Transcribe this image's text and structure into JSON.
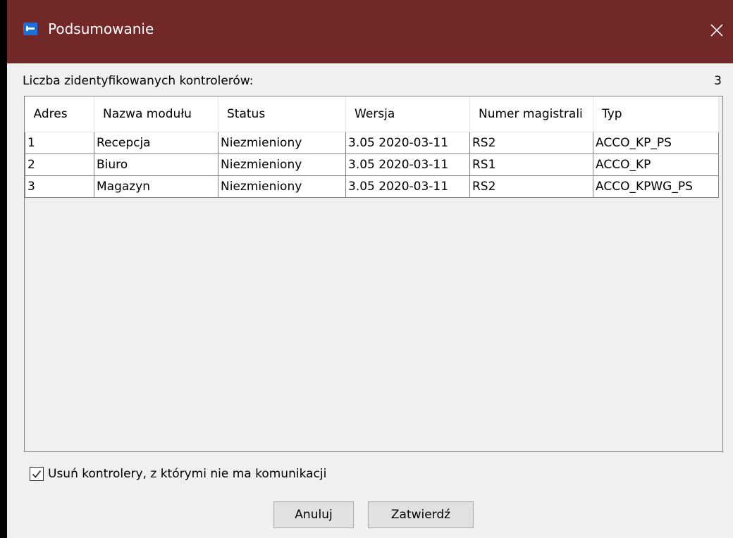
{
  "window": {
    "title": "Podsumowanie",
    "close_label": "×"
  },
  "summary": {
    "count_label": "Liczba zidentyfikowanych kontrolerów:",
    "count_value": "3"
  },
  "table": {
    "columns": [
      "Adres",
      "Nazwa modułu",
      "Status",
      "Wersja",
      "Numer magistrali",
      "Typ"
    ],
    "rows": [
      [
        "1",
        "Recepcja",
        "Niezmieniony",
        "3.05 2020-03-11",
        "RS2",
        "ACCO_KP_PS"
      ],
      [
        "2",
        "Biuro",
        "Niezmieniony",
        "3.05 2020-03-11",
        "RS1",
        "ACCO_KP"
      ],
      [
        "3",
        "Magazyn",
        "Niezmieniony",
        "3.05 2020-03-11",
        "RS2",
        "ACCO_KPWG_PS"
      ]
    ]
  },
  "options": {
    "remove_label": "Usuń kontrolery, z którymi nie ma komunikacji",
    "remove_checked": true
  },
  "buttons": {
    "cancel": "Anuluj",
    "confirm": "Zatwierdź"
  },
  "colors": {
    "titlebar": "#732828",
    "app_icon": "#1f6fd6"
  },
  "icons": {
    "app": "key-card-icon",
    "close": "close-icon",
    "check": "checkmark-icon"
  }
}
